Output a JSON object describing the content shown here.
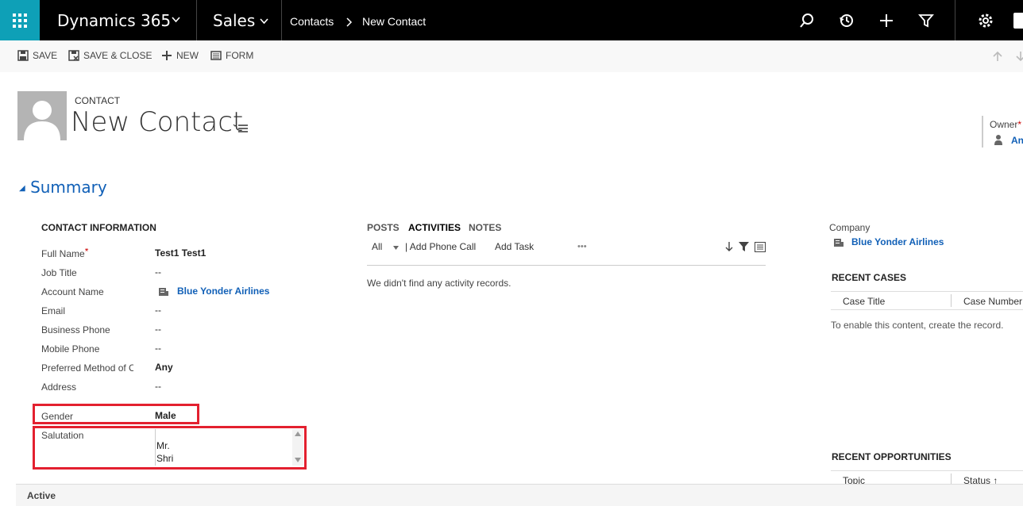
{
  "nav": {
    "app_title": "Dynamics 365",
    "module": "Sales",
    "breadcrumb": [
      "Contacts",
      "New Contact"
    ]
  },
  "toolbar": {
    "save": "SAVE",
    "save_close": "SAVE & CLOSE",
    "new": "NEW",
    "form": "FORM"
  },
  "header": {
    "entity_type": "CONTACT",
    "title": "New Contact",
    "owner_label": "Owner",
    "owner_required": "*",
    "owner_value": "An"
  },
  "summary": {
    "section_title": "Summary",
    "contact_info": {
      "heading": "CONTACT INFORMATION",
      "fields": [
        {
          "label": "Full Name",
          "required": "*",
          "value": "Test1 Test1"
        },
        {
          "label": "Job Title",
          "value": "--"
        },
        {
          "label": "Account Name",
          "value": "Blue Yonder Airlines"
        },
        {
          "label": "Email",
          "value": "--"
        },
        {
          "label": "Business Phone",
          "value": "--"
        },
        {
          "label": "Mobile Phone",
          "value": "--"
        },
        {
          "label": "Preferred Method of C",
          "value": "Any"
        },
        {
          "label": "Address",
          "value": "--"
        },
        {
          "label": "Gender",
          "value": "Male"
        },
        {
          "label": "Salutation",
          "value_lines": [
            "Mr.",
            "Shri"
          ]
        }
      ]
    }
  },
  "activities": {
    "tabs": [
      "POSTS",
      "ACTIVITIES",
      "NOTES"
    ],
    "filter": "All",
    "add_phone_call": "| Add Phone Call",
    "add_task": "Add Task",
    "more": "•••",
    "empty_message": "We didn't find any activity records."
  },
  "right": {
    "company_label": "Company",
    "company_value": "Blue Yonder Airlines",
    "recent_cases": {
      "heading": "RECENT CASES",
      "columns": [
        "Case Title",
        "Case Number"
      ],
      "message": "To enable this content, create the record."
    },
    "recent_opportunities": {
      "heading": "RECENT OPPORTUNITIES",
      "columns": [
        "Topic",
        "Status ↑"
      ]
    }
  },
  "footer": {
    "status": "Active"
  },
  "colors": {
    "accent": "#0ea0b7",
    "link": "#1160b7",
    "highlight": "#e3202f",
    "nav_bg": "#000000"
  }
}
